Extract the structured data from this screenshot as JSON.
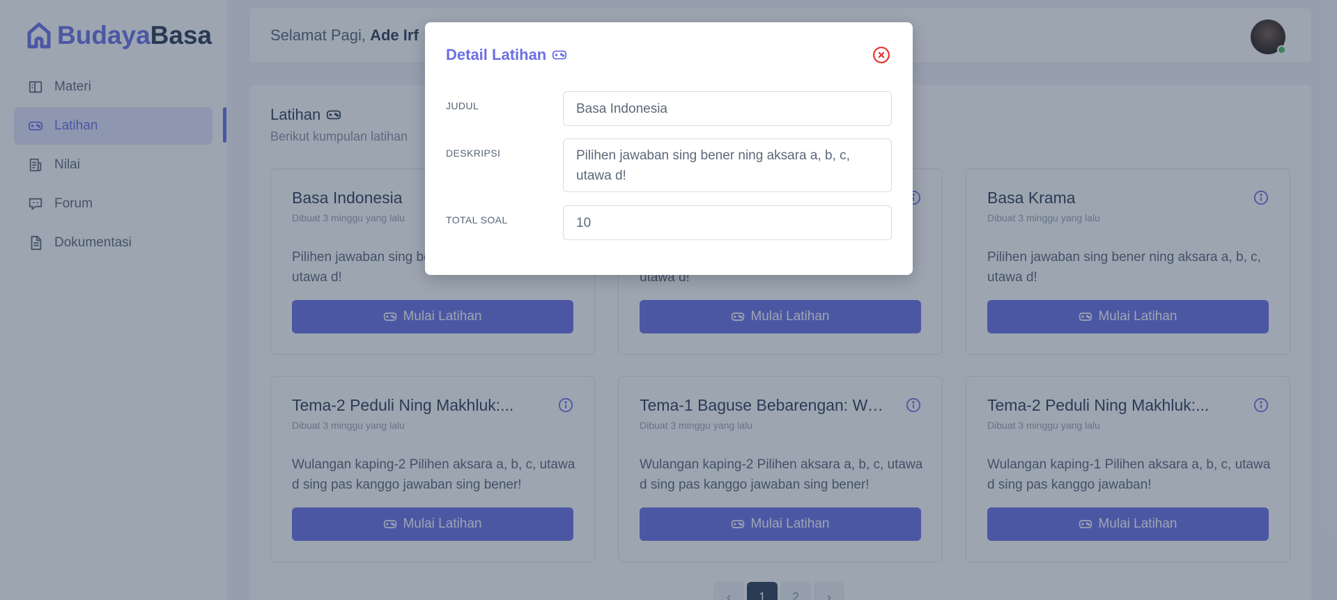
{
  "brand": {
    "part1": "Budaya",
    "part2": "Basa"
  },
  "sidebar": {
    "items": [
      {
        "label": "Materi",
        "icon": "book-open-icon",
        "active": false
      },
      {
        "label": "Latihan",
        "icon": "gamepad-icon",
        "active": true
      },
      {
        "label": "Nilai",
        "icon": "report-icon",
        "active": false
      },
      {
        "label": "Forum",
        "icon": "chat-icon",
        "active": false
      },
      {
        "label": "Dokumentasi",
        "icon": "document-icon",
        "active": false
      }
    ]
  },
  "header": {
    "greeting": "Selamat Pagi,",
    "user_name": "Ade Irf"
  },
  "main": {
    "title": "Latihan",
    "subtitle": "Berikut kumpulan latihan",
    "cards": [
      {
        "title": "Basa Indonesia",
        "date": "Dibuat 3 minggu yang lalu",
        "desc": "Pilihen jawaban sing bener ning aksara a, b, c, utawa d!",
        "button": "Mulai Latihan"
      },
      {
        "title": "",
        "date": "",
        "desc": "utawa d!",
        "button": "Mulai Latihan"
      },
      {
        "title": "Basa Krama",
        "date": "Dibuat 3 minggu yang lalu",
        "desc": "Pilihen jawaban sing bener ning aksara a, b, c, utawa d!",
        "button": "Mulai Latihan"
      },
      {
        "title": "Tema-2 Peduli Ning Makhluk:...",
        "date": "Dibuat 3 minggu yang lalu",
        "desc": "Wulangan kaping-2 Pilihen aksara a, b, c, utawa d sing pas kanggo jawaban sing bener!",
        "button": "Mulai Latihan"
      },
      {
        "title": "Tema-1 Baguse Bebarengan: Wu...",
        "date": "Dibuat 3 minggu yang lalu",
        "desc": "Wulangan kaping-2 Pilihen aksara a, b, c, utawa d sing pas kanggo jawaban sing bener!",
        "button": "Mulai Latihan"
      },
      {
        "title": "Tema-2 Peduli Ning Makhluk:...",
        "date": "Dibuat 3 minggu yang lalu",
        "desc": "Wulangan kaping-1 Pilihen aksara a, b, c, utawa d sing pas kanggo jawaban!",
        "button": "Mulai Latihan"
      }
    ]
  },
  "pagination": {
    "prev": "‹",
    "pages": [
      "1",
      "2"
    ],
    "next": "›",
    "current": "1"
  },
  "modal": {
    "title": "Detail Latihan",
    "fields": [
      {
        "label": "JUDUL",
        "value": "Basa Indonesia"
      },
      {
        "label": "DESKRIPSI",
        "value": "Pilihen jawaban sing bener ning aksara a, b, c, utawa d!"
      },
      {
        "label": "TOTAL SOAL",
        "value": "10"
      }
    ]
  },
  "colors": {
    "accent": "#6c71e8",
    "dark": "#2f3f56",
    "overlay": "rgba(38,56,82,0.45)",
    "close": "#e5332a",
    "online": "#4cc468"
  }
}
